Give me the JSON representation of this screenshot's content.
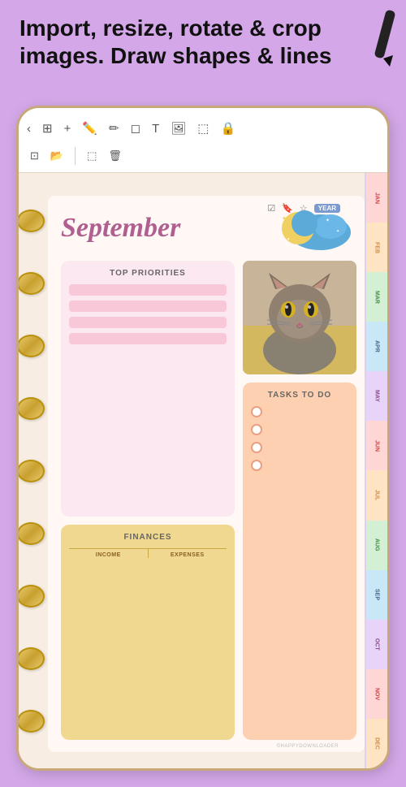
{
  "header": {
    "text_line1": "Import, resize, rotate & crop",
    "text_line2": "images. Draw shapes & lines"
  },
  "toolbar": {
    "row1_icons": [
      "‹",
      "⊞",
      "+",
      "✏",
      "✏",
      "✏",
      "T",
      "🖼",
      "⬚",
      "🔒"
    ],
    "row2_icons": [
      "⊡",
      "📂",
      "|",
      "⬚",
      "🗑"
    ]
  },
  "planner": {
    "top_bar": {
      "icons": [
        "☑",
        "🔖",
        "☆"
      ],
      "year_badge": "YEAR"
    },
    "tabs": [
      "JAN",
      "FEB",
      "MAR",
      "APR",
      "MAY",
      "JUN",
      "JUL",
      "AUG",
      "SEP",
      "OCT",
      "NOV",
      "DEC"
    ],
    "september": {
      "title": "September"
    },
    "priorities": {
      "title": "TOP PRIORITIES",
      "lines": 4
    },
    "finances": {
      "title": "FINANCES",
      "income_label": "INCOME",
      "expenses_label": "EXPENSES"
    },
    "tasks": {
      "title": "TASKS TO DO",
      "items": 4
    },
    "watermark": "©HAPPYDOWNLOADER"
  }
}
